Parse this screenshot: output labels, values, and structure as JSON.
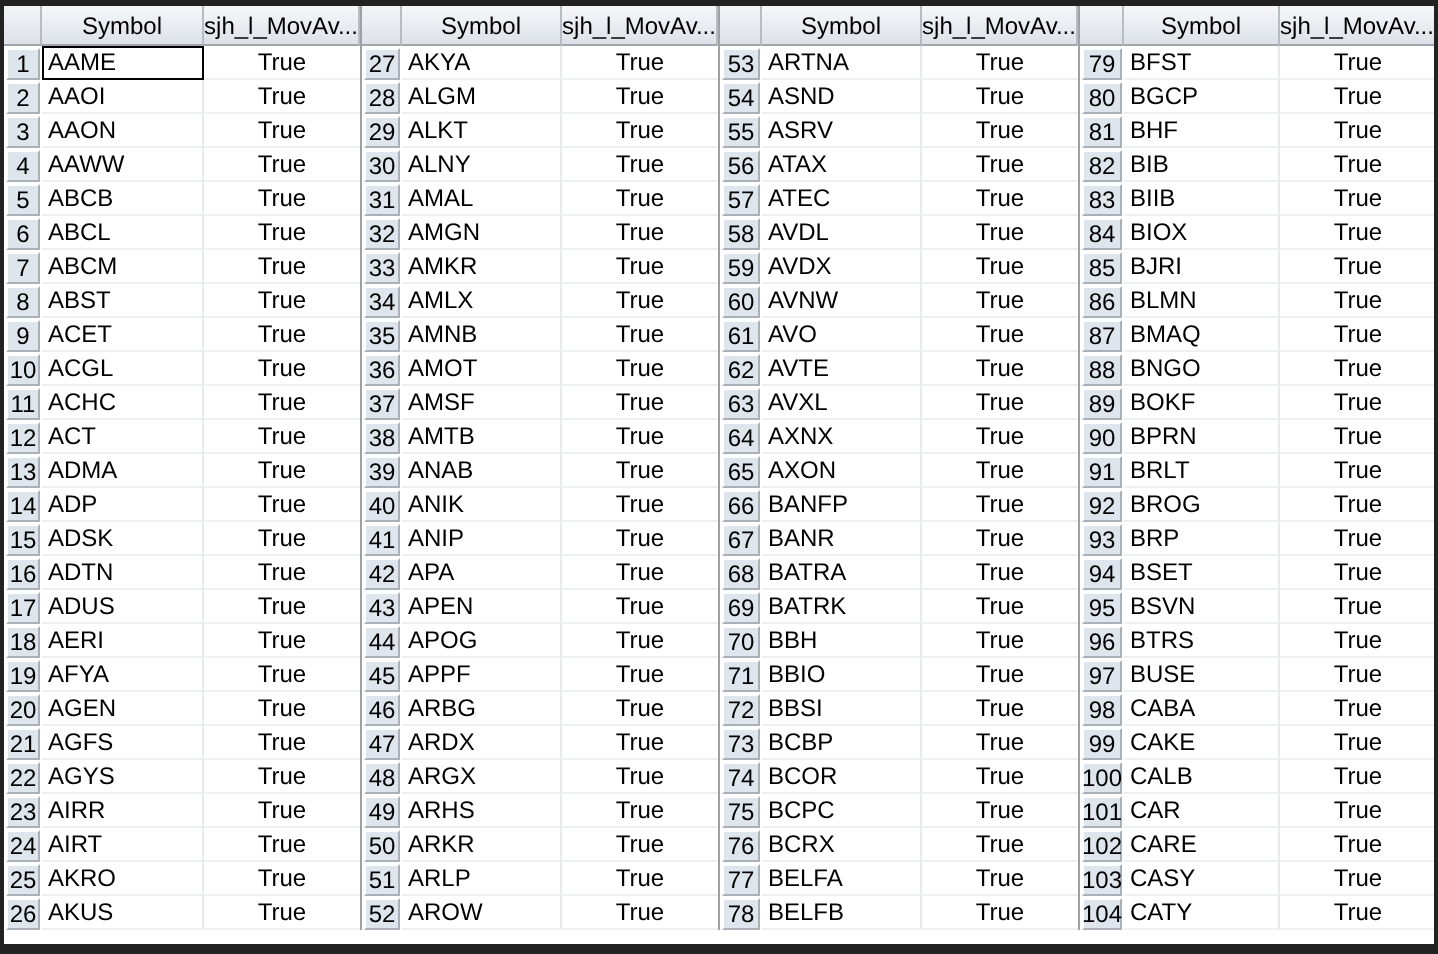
{
  "panels": [
    {
      "columns": [
        "Symbol",
        "sjh_l_MovAv..."
      ],
      "rows": [
        {
          "n": "1",
          "symbol": "AAME",
          "value": "True",
          "selected": true
        },
        {
          "n": "2",
          "symbol": "AAOI",
          "value": "True",
          "selected": false
        },
        {
          "n": "3",
          "symbol": "AAON",
          "value": "True",
          "selected": false
        },
        {
          "n": "4",
          "symbol": "AAWW",
          "value": "True",
          "selected": false
        },
        {
          "n": "5",
          "symbol": "ABCB",
          "value": "True",
          "selected": false
        },
        {
          "n": "6",
          "symbol": "ABCL",
          "value": "True",
          "selected": false
        },
        {
          "n": "7",
          "symbol": "ABCM",
          "value": "True",
          "selected": false
        },
        {
          "n": "8",
          "symbol": "ABST",
          "value": "True",
          "selected": false
        },
        {
          "n": "9",
          "symbol": "ACET",
          "value": "True",
          "selected": false
        },
        {
          "n": "10",
          "symbol": "ACGL",
          "value": "True",
          "selected": false
        },
        {
          "n": "11",
          "symbol": "ACHC",
          "value": "True",
          "selected": false
        },
        {
          "n": "12",
          "symbol": "ACT",
          "value": "True",
          "selected": false
        },
        {
          "n": "13",
          "symbol": "ADMA",
          "value": "True",
          "selected": false
        },
        {
          "n": "14",
          "symbol": "ADP",
          "value": "True",
          "selected": false
        },
        {
          "n": "15",
          "symbol": "ADSK",
          "value": "True",
          "selected": false
        },
        {
          "n": "16",
          "symbol": "ADTN",
          "value": "True",
          "selected": false
        },
        {
          "n": "17",
          "symbol": "ADUS",
          "value": "True",
          "selected": false
        },
        {
          "n": "18",
          "symbol": "AERI",
          "value": "True",
          "selected": false
        },
        {
          "n": "19",
          "symbol": "AFYA",
          "value": "True",
          "selected": false
        },
        {
          "n": "20",
          "symbol": "AGEN",
          "value": "True",
          "selected": false
        },
        {
          "n": "21",
          "symbol": "AGFS",
          "value": "True",
          "selected": false
        },
        {
          "n": "22",
          "symbol": "AGYS",
          "value": "True",
          "selected": false
        },
        {
          "n": "23",
          "symbol": "AIRR",
          "value": "True",
          "selected": false
        },
        {
          "n": "24",
          "symbol": "AIRT",
          "value": "True",
          "selected": false
        },
        {
          "n": "25",
          "symbol": "AKRO",
          "value": "True",
          "selected": false
        },
        {
          "n": "26",
          "symbol": "AKUS",
          "value": "True",
          "selected": false
        }
      ]
    },
    {
      "columns": [
        "Symbol",
        "sjh_l_MovAv..."
      ],
      "rows": [
        {
          "n": "27",
          "symbol": "AKYA",
          "value": "True",
          "selected": false
        },
        {
          "n": "28",
          "symbol": "ALGM",
          "value": "True",
          "selected": false
        },
        {
          "n": "29",
          "symbol": "ALKT",
          "value": "True",
          "selected": false
        },
        {
          "n": "30",
          "symbol": "ALNY",
          "value": "True",
          "selected": false
        },
        {
          "n": "31",
          "symbol": "AMAL",
          "value": "True",
          "selected": false
        },
        {
          "n": "32",
          "symbol": "AMGN",
          "value": "True",
          "selected": false
        },
        {
          "n": "33",
          "symbol": "AMKR",
          "value": "True",
          "selected": false
        },
        {
          "n": "34",
          "symbol": "AMLX",
          "value": "True",
          "selected": false
        },
        {
          "n": "35",
          "symbol": "AMNB",
          "value": "True",
          "selected": false
        },
        {
          "n": "36",
          "symbol": "AMOT",
          "value": "True",
          "selected": false
        },
        {
          "n": "37",
          "symbol": "AMSF",
          "value": "True",
          "selected": false
        },
        {
          "n": "38",
          "symbol": "AMTB",
          "value": "True",
          "selected": false
        },
        {
          "n": "39",
          "symbol": "ANAB",
          "value": "True",
          "selected": false
        },
        {
          "n": "40",
          "symbol": "ANIK",
          "value": "True",
          "selected": false
        },
        {
          "n": "41",
          "symbol": "ANIP",
          "value": "True",
          "selected": false
        },
        {
          "n": "42",
          "symbol": "APA",
          "value": "True",
          "selected": false
        },
        {
          "n": "43",
          "symbol": "APEN",
          "value": "True",
          "selected": false
        },
        {
          "n": "44",
          "symbol": "APOG",
          "value": "True",
          "selected": false
        },
        {
          "n": "45",
          "symbol": "APPF",
          "value": "True",
          "selected": false
        },
        {
          "n": "46",
          "symbol": "ARBG",
          "value": "True",
          "selected": false
        },
        {
          "n": "47",
          "symbol": "ARDX",
          "value": "True",
          "selected": false
        },
        {
          "n": "48",
          "symbol": "ARGX",
          "value": "True",
          "selected": false
        },
        {
          "n": "49",
          "symbol": "ARHS",
          "value": "True",
          "selected": false
        },
        {
          "n": "50",
          "symbol": "ARKR",
          "value": "True",
          "selected": false
        },
        {
          "n": "51",
          "symbol": "ARLP",
          "value": "True",
          "selected": false
        },
        {
          "n": "52",
          "symbol": "AROW",
          "value": "True",
          "selected": false
        }
      ]
    },
    {
      "columns": [
        "Symbol",
        "sjh_l_MovAv..."
      ],
      "rows": [
        {
          "n": "53",
          "symbol": "ARTNA",
          "value": "True",
          "selected": false
        },
        {
          "n": "54",
          "symbol": "ASND",
          "value": "True",
          "selected": false
        },
        {
          "n": "55",
          "symbol": "ASRV",
          "value": "True",
          "selected": false
        },
        {
          "n": "56",
          "symbol": "ATAX",
          "value": "True",
          "selected": false
        },
        {
          "n": "57",
          "symbol": "ATEC",
          "value": "True",
          "selected": false
        },
        {
          "n": "58",
          "symbol": "AVDL",
          "value": "True",
          "selected": false
        },
        {
          "n": "59",
          "symbol": "AVDX",
          "value": "True",
          "selected": false
        },
        {
          "n": "60",
          "symbol": "AVNW",
          "value": "True",
          "selected": false
        },
        {
          "n": "61",
          "symbol": "AVO",
          "value": "True",
          "selected": false
        },
        {
          "n": "62",
          "symbol": "AVTE",
          "value": "True",
          "selected": false
        },
        {
          "n": "63",
          "symbol": "AVXL",
          "value": "True",
          "selected": false
        },
        {
          "n": "64",
          "symbol": "AXNX",
          "value": "True",
          "selected": false
        },
        {
          "n": "65",
          "symbol": "AXON",
          "value": "True",
          "selected": false
        },
        {
          "n": "66",
          "symbol": "BANFP",
          "value": "True",
          "selected": false
        },
        {
          "n": "67",
          "symbol": "BANR",
          "value": "True",
          "selected": false
        },
        {
          "n": "68",
          "symbol": "BATRA",
          "value": "True",
          "selected": false
        },
        {
          "n": "69",
          "symbol": "BATRK",
          "value": "True",
          "selected": false
        },
        {
          "n": "70",
          "symbol": "BBH",
          "value": "True",
          "selected": false
        },
        {
          "n": "71",
          "symbol": "BBIO",
          "value": "True",
          "selected": false
        },
        {
          "n": "72",
          "symbol": "BBSI",
          "value": "True",
          "selected": false
        },
        {
          "n": "73",
          "symbol": "BCBP",
          "value": "True",
          "selected": false
        },
        {
          "n": "74",
          "symbol": "BCOR",
          "value": "True",
          "selected": false
        },
        {
          "n": "75",
          "symbol": "BCPC",
          "value": "True",
          "selected": false
        },
        {
          "n": "76",
          "symbol": "BCRX",
          "value": "True",
          "selected": false
        },
        {
          "n": "77",
          "symbol": "BELFA",
          "value": "True",
          "selected": false
        },
        {
          "n": "78",
          "symbol": "BELFB",
          "value": "True",
          "selected": false
        }
      ]
    },
    {
      "columns": [
        "Symbol",
        "sjh_l_MovAv..."
      ],
      "rows": [
        {
          "n": "79",
          "symbol": "BFST",
          "value": "True",
          "selected": false
        },
        {
          "n": "80",
          "symbol": "BGCP",
          "value": "True",
          "selected": false
        },
        {
          "n": "81",
          "symbol": "BHF",
          "value": "True",
          "selected": false
        },
        {
          "n": "82",
          "symbol": "BIB",
          "value": "True",
          "selected": false
        },
        {
          "n": "83",
          "symbol": "BIIB",
          "value": "True",
          "selected": false
        },
        {
          "n": "84",
          "symbol": "BIOX",
          "value": "True",
          "selected": false
        },
        {
          "n": "85",
          "symbol": "BJRI",
          "value": "True",
          "selected": false
        },
        {
          "n": "86",
          "symbol": "BLMN",
          "value": "True",
          "selected": false
        },
        {
          "n": "87",
          "symbol": "BMAQ",
          "value": "True",
          "selected": false
        },
        {
          "n": "88",
          "symbol": "BNGO",
          "value": "True",
          "selected": false
        },
        {
          "n": "89",
          "symbol": "BOKF",
          "value": "True",
          "selected": false
        },
        {
          "n": "90",
          "symbol": "BPRN",
          "value": "True",
          "selected": false
        },
        {
          "n": "91",
          "symbol": "BRLT",
          "value": "True",
          "selected": false
        },
        {
          "n": "92",
          "symbol": "BROG",
          "value": "True",
          "selected": false
        },
        {
          "n": "93",
          "symbol": "BRP",
          "value": "True",
          "selected": false
        },
        {
          "n": "94",
          "symbol": "BSET",
          "value": "True",
          "selected": false
        },
        {
          "n": "95",
          "symbol": "BSVN",
          "value": "True",
          "selected": false
        },
        {
          "n": "96",
          "symbol": "BTRS",
          "value": "True",
          "selected": false
        },
        {
          "n": "97",
          "symbol": "BUSE",
          "value": "True",
          "selected": false
        },
        {
          "n": "98",
          "symbol": "CABA",
          "value": "True",
          "selected": false
        },
        {
          "n": "99",
          "symbol": "CAKE",
          "value": "True",
          "selected": false
        },
        {
          "n": "100",
          "symbol": "CALB",
          "value": "True",
          "selected": false
        },
        {
          "n": "101",
          "symbol": "CAR",
          "value": "True",
          "selected": false
        },
        {
          "n": "102",
          "symbol": "CARE",
          "value": "True",
          "selected": false
        },
        {
          "n": "103",
          "symbol": "CASY",
          "value": "True",
          "selected": false
        },
        {
          "n": "104",
          "symbol": "CATY",
          "value": "True",
          "selected": false
        }
      ]
    }
  ]
}
